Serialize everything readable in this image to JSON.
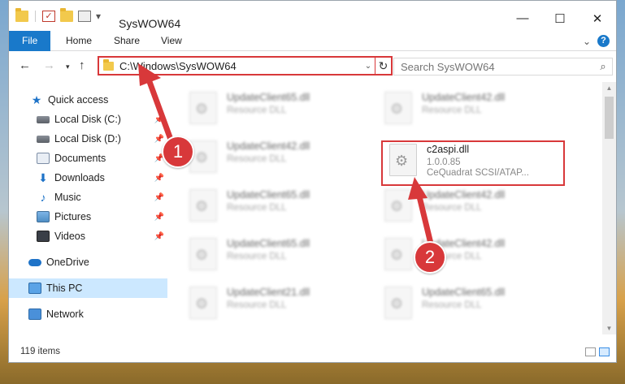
{
  "window": {
    "title": "SysWOW64",
    "controls": {
      "minimize": "—",
      "maximize": "☐",
      "close": "✕"
    }
  },
  "ribbon": {
    "tabs": [
      {
        "label": "File"
      },
      {
        "label": "Home"
      },
      {
        "label": "Share"
      },
      {
        "label": "View"
      }
    ],
    "help": "?"
  },
  "nav": {
    "address": "C:\\Windows\\SysWOW64",
    "search_placeholder": "Search SysWOW64"
  },
  "sidebar": {
    "items": [
      {
        "label": "Quick access",
        "icon": "star-icon"
      },
      {
        "label": "Local Disk (C:)",
        "icon": "disk-icon"
      },
      {
        "label": "Local Disk (D:)",
        "icon": "disk-icon"
      },
      {
        "label": "Documents",
        "icon": "documents-icon"
      },
      {
        "label": "Downloads",
        "icon": "downloads-icon"
      },
      {
        "label": "Music",
        "icon": "music-icon"
      },
      {
        "label": "Pictures",
        "icon": "pictures-icon"
      },
      {
        "label": "Videos",
        "icon": "videos-icon"
      },
      {
        "label": "OneDrive",
        "icon": "onedrive-icon"
      },
      {
        "label": "This PC",
        "icon": "this-pc-icon"
      },
      {
        "label": "Network",
        "icon": "network-icon"
      }
    ]
  },
  "files": {
    "left": [
      {
        "name": "UpdateClient65.dll",
        "type": "Resource DLL"
      },
      {
        "name": "UpdateClient42.dll",
        "type": "Resource DLL"
      },
      {
        "name": "UpdateClient65.dll",
        "type": "Resource DLL"
      },
      {
        "name": "UpdateClient65.dll",
        "type": "Resource DLL"
      },
      {
        "name": "UpdateClient21.dll",
        "type": "Resource DLL"
      }
    ],
    "right": [
      {
        "name": "UpdateClient42.dll",
        "type": "Resource DLL"
      },
      {
        "name": "UpdateClient42.dll",
        "type": "Resource DLL"
      },
      {
        "name": "UpdateClient42.dll",
        "type": "Resource DLL"
      },
      {
        "name": "UpdateClient65.dll",
        "type": "Resource DLL"
      }
    ],
    "highlighted": {
      "name": "c2aspi.dll",
      "version": "1.0.0.85",
      "description": "CeQuadrat SCSI/ATAP..."
    }
  },
  "status": {
    "item_count": "119 items"
  },
  "callouts": {
    "one": "1",
    "two": "2"
  },
  "colors": {
    "accent": "#1979ca",
    "annotation": "#d8383a",
    "selection": "#cce8ff"
  }
}
